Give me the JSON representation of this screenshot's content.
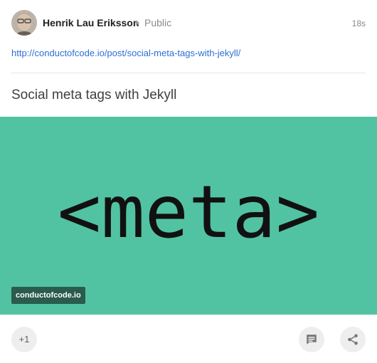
{
  "post": {
    "author": "Henrik Lau Eriksson",
    "visibility": "Public",
    "time": "18s",
    "link": "http://conductofcode.io/post/social-meta-tags-with-jekyll/",
    "title": "Social meta tags with Jekyll"
  },
  "image": {
    "text": "<meta>",
    "watermark": "conductofcode.io",
    "background": "#52c3a2"
  },
  "actions": {
    "plus_one": "+1",
    "comment_icon": "comment-icon",
    "share_icon": "share-icon"
  },
  "colors": {
    "link": "#2a6fd6",
    "accent": "#52c3a2"
  }
}
